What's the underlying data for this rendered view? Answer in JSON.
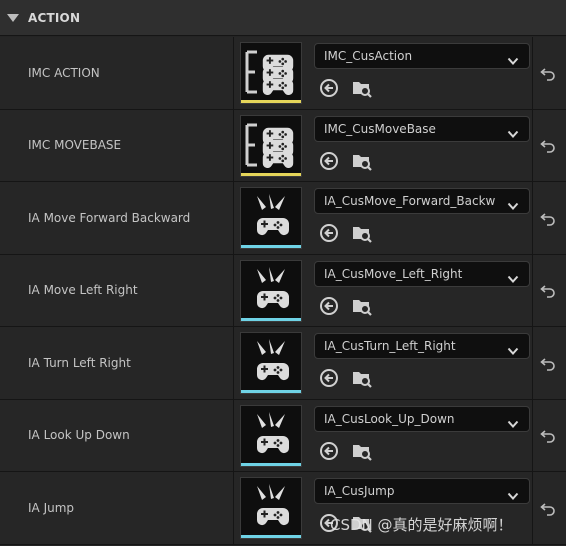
{
  "section": {
    "title": "ACTION"
  },
  "rows": [
    {
      "label": "IMC ACTION",
      "asset": "IMC_CusAction",
      "kind": "imc",
      "accent": "#e6d65a"
    },
    {
      "label": "IMC MOVEBASE",
      "asset": "IMC_CusMoveBase",
      "kind": "imc",
      "accent": "#e6d65a"
    },
    {
      "label": "IA Move Forward Backward",
      "asset": "IA_CusMove_Forward_Backw",
      "kind": "ia",
      "accent": "#6fd3e6"
    },
    {
      "label": "IA Move Left Right",
      "asset": "IA_CusMove_Left_Right",
      "kind": "ia",
      "accent": "#6fd3e6"
    },
    {
      "label": "IA Turn Left Right",
      "asset": "IA_CusTurn_Left_Right",
      "kind": "ia",
      "accent": "#6fd3e6"
    },
    {
      "label": "IA Look Up Down",
      "asset": "IA_CusLook_Up_Down",
      "kind": "ia",
      "accent": "#6fd3e6"
    },
    {
      "label": "IA Jump",
      "asset": "IA_CusJump",
      "kind": "ia",
      "accent": "#6fd3e6"
    }
  ],
  "icons": {
    "use_selected": "arrow-left-circle-icon",
    "browse": "folder-search-icon",
    "reset": "reset-arrow-icon",
    "expand": "triangle-down-icon",
    "dropdown": "chevron-down-icon"
  },
  "watermark": "CSDN @真的是好麻烦啊！"
}
